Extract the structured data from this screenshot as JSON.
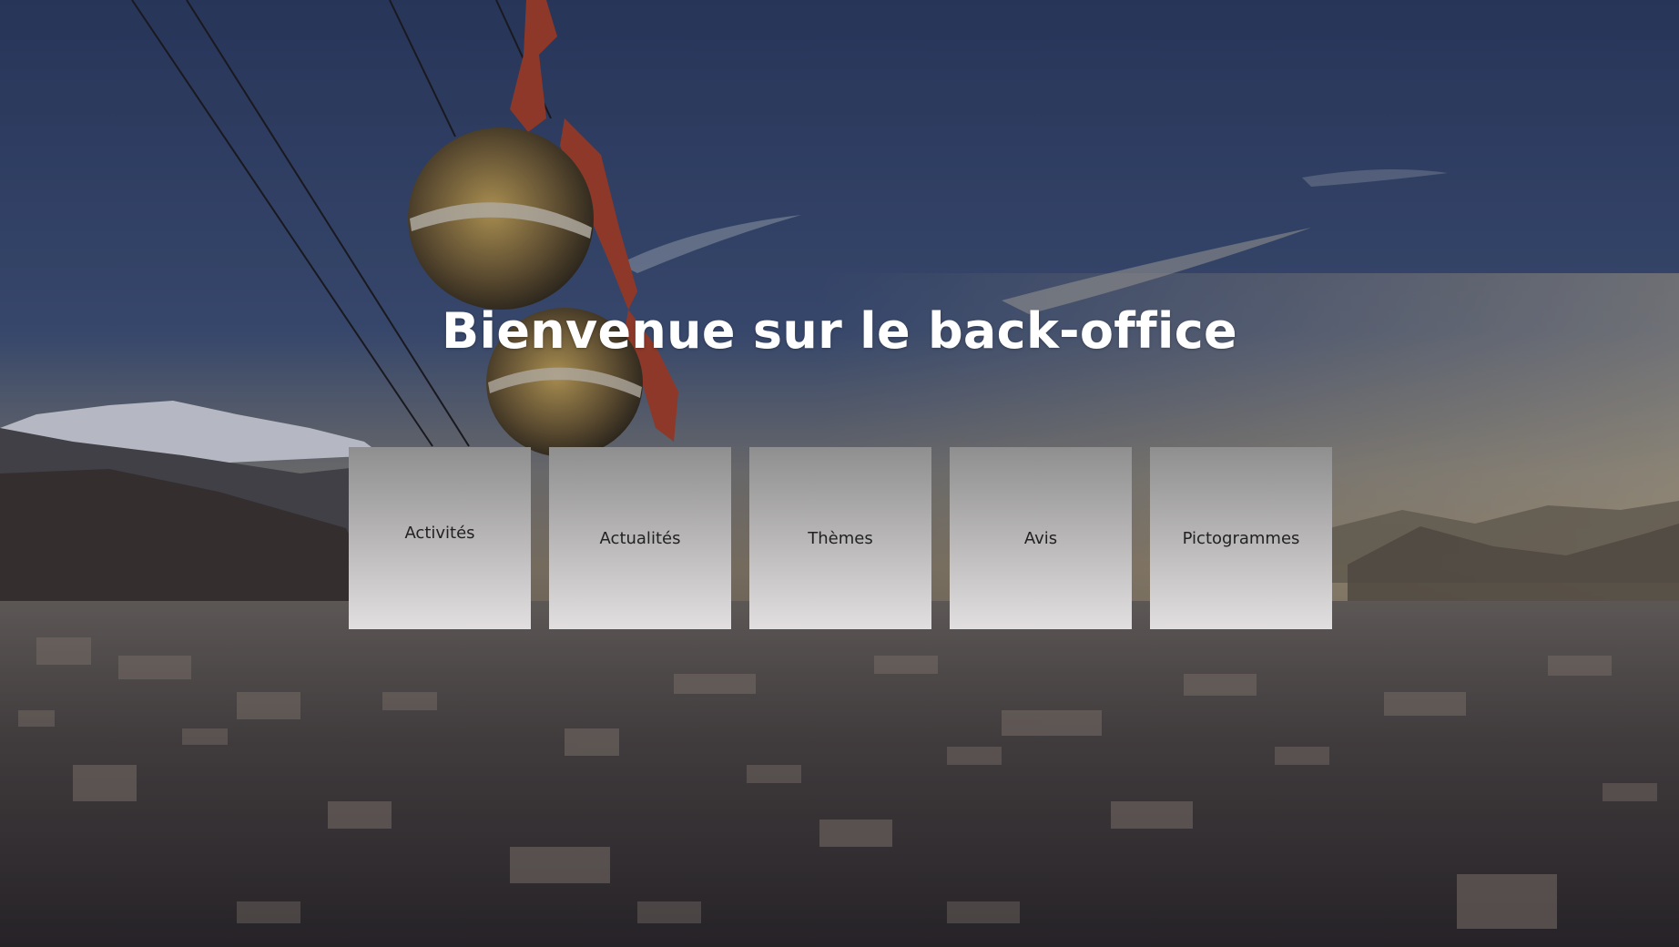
{
  "page": {
    "headline": "Bienvenue sur le back-office"
  },
  "tiles": [
    {
      "id": "activites",
      "label": "Activités"
    },
    {
      "id": "actualites",
      "label": "Actualités"
    },
    {
      "id": "themes",
      "label": "Thèmes"
    },
    {
      "id": "avis",
      "label": "Avis"
    },
    {
      "id": "pictogrammes",
      "label": "Pictogrammes"
    }
  ],
  "colors": {
    "headline_text": "#ffffff",
    "tile_gradient_top": "#8f8f8f",
    "tile_gradient_bottom": "#e2dfe0",
    "tile_text": "#222222"
  }
}
